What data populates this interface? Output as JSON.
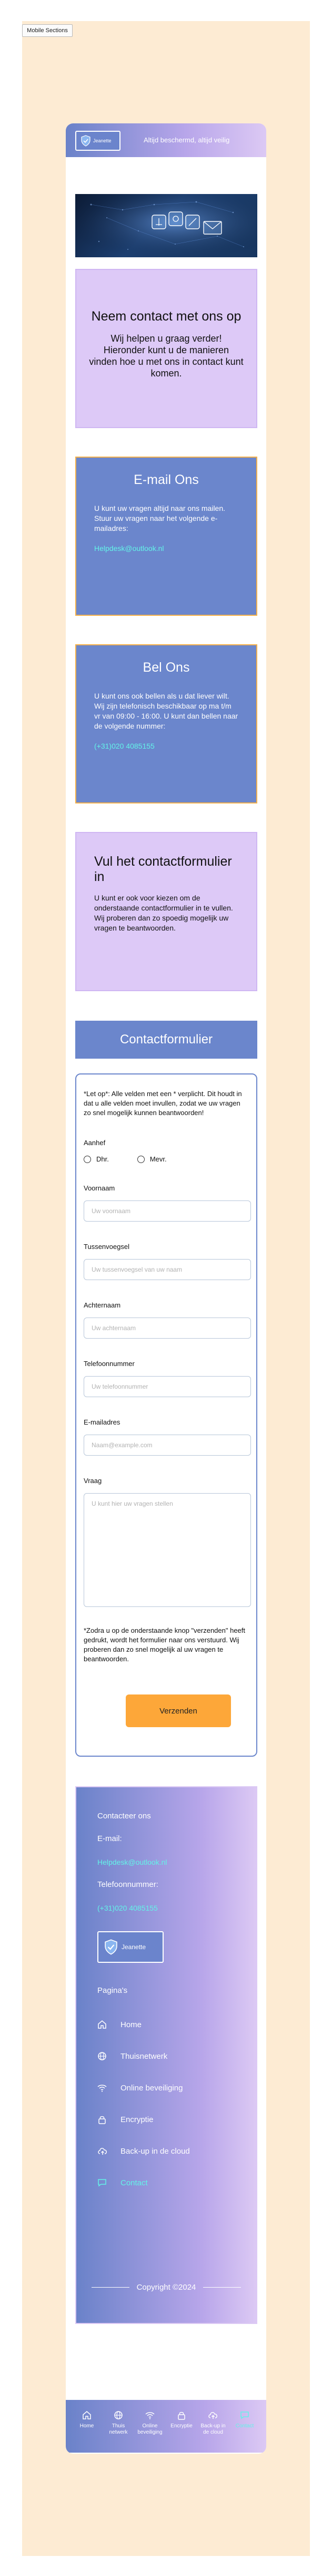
{
  "frame_label": "Mobile Sections",
  "header": {
    "logo_text": "Jeanette",
    "slogan": "Altijd beschermd, altijd veilig"
  },
  "contact_card": {
    "title": "Neem contact met ons op",
    "subtitle": "Wij helpen u graag verder! Hieronder kunt u de manieren vinden hoe u met ons in contact kunt komen."
  },
  "email_card": {
    "title": "E-mail Ons",
    "body": "U kunt uw vragen altijd naar ons mailen. Stuur uw vragen naar het volgende e-mailadres:",
    "link": "Helpdesk@outlook.nl"
  },
  "bel_card": {
    "title": "Bel Ons",
    "body": "U kunt ons ook bellen als u dat liever wilt. Wij zijn telefonisch beschikbaar op ma t/m vr van 09:00 - 16:00. U kunt dan bellen naar de volgende nummer:",
    "link": "(+31)020 4085155"
  },
  "form_card": {
    "title": "Vul het contactformulier in",
    "body": "U kunt er ook voor kiezen om de onderstaande contactformulier in te vullen. Wij proberen dan zo spoedig mogelijk uw vragen te beantwoorden."
  },
  "contactform": {
    "title": "Contactformulier",
    "note": "*Let op*: Alle velden met een * verplicht. Dit houdt in dat u alle velden moet invullen, zodat we uw vragen zo snel mogelijk kunnen beantwoorden!",
    "aanhef_label": "Aanhef",
    "aanhef_options": [
      "Dhr.",
      "Mevr."
    ],
    "voornaam_label": "Voornaam",
    "voornaam_placeholder": "Uw voornaam",
    "tussenvoegsel_label": "Tussenvoegsel",
    "tussenvoegsel_placeholder": "Uw tussenvoegsel van uw naam",
    "achternaam_label": "Achternaam",
    "achternaam_placeholder": "Uw achternaam",
    "telefoon_label": "Telefoonnummer",
    "telefoon_placeholder": "Uw telefoonnummer",
    "email_label": "E-mailadres",
    "email_placeholder": "Naam@example.com",
    "vraag_label": "Vraag",
    "vraag_placeholder": "U kunt hier uw vragen stellen",
    "submit_note": "*Zodra u op de onderstaande knop \"verzenden\" heeft gedrukt, wordt het formulier naar ons verstuurd. Wij proberen dan zo snel mogelijk al uw vragen te beantwoorden.",
    "submit_label": "Verzenden"
  },
  "footer": {
    "contact_heading": "Contacteer ons",
    "email_heading": "E-mail:",
    "email": "Helpdesk@outlook.nl",
    "phone_heading": "Telefoonnummer:",
    "phone": "(+31)020 4085155",
    "logo_text": "Jeanette",
    "pages_heading": "Pagina's",
    "nav": [
      {
        "label": "Home",
        "icon": "home-icon"
      },
      {
        "label": "Thuisnetwerk",
        "icon": "globe-icon"
      },
      {
        "label": "Online beveiliging",
        "icon": "wifi-icon"
      },
      {
        "label": "Encryptie",
        "icon": "lock-icon"
      },
      {
        "label": "Back-up in de cloud",
        "icon": "cloud-upload-icon"
      },
      {
        "label": "Contact",
        "icon": "chat-icon"
      }
    ],
    "copyright": "Copyright ©2024"
  },
  "tabbar": [
    {
      "label": "Home",
      "icon": "home-icon"
    },
    {
      "label": "Thuis netwerk",
      "icon": "globe-icon"
    },
    {
      "label": "Online beveiliging",
      "icon": "wifi-icon"
    },
    {
      "label": "Encryptie",
      "icon": "lock-icon"
    },
    {
      "label": "Back-up in de cloud",
      "icon": "cloud-upload-icon"
    },
    {
      "label": "Contact",
      "icon": "chat-icon"
    }
  ],
  "colors": {
    "blue": "#6b86cc",
    "purple": "#ddc9f7",
    "accent_link": "#63f3e8",
    "button": "#fda739",
    "canvas": "#fdebd3"
  }
}
